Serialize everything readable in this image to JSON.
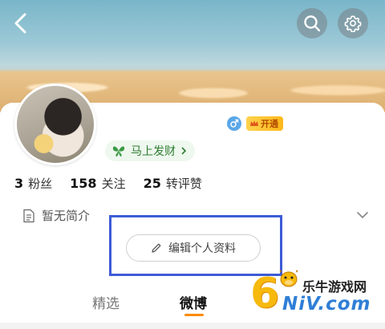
{
  "header": {
    "back_icon": "chevron-left-icon",
    "search_icon": "search-icon",
    "settings_icon": "gear-icon"
  },
  "profile": {
    "gender_icon": "male-icon",
    "vip_label": "开通",
    "fortune_label": "马上发财",
    "stats": [
      {
        "number": "3",
        "label": "粉丝"
      },
      {
        "number": "158",
        "label": "关注"
      },
      {
        "number": "25",
        "label": "转评赞"
      }
    ],
    "bio": "暂无简介",
    "edit_button": "编辑个人资料"
  },
  "tabs": [
    {
      "label": "精选",
      "active": false
    },
    {
      "label": "微博",
      "active": true
    }
  ],
  "watermark": {
    "six": "6",
    "title": "乐牛游戏网",
    "sub": "NiV.com"
  },
  "colors": {
    "accent": "#ff8a00",
    "highlight_box": "#3d5bd6",
    "fortune_green": "#2e7d32",
    "vip_gold": "#ffc21a"
  }
}
